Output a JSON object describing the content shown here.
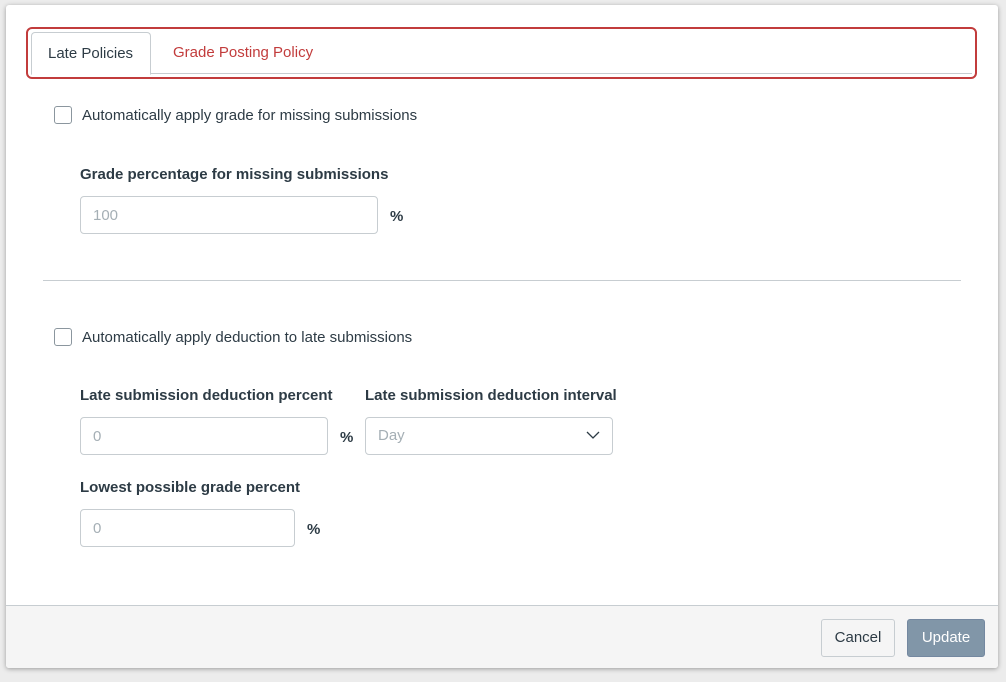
{
  "tabs": [
    {
      "label": "Late Policies",
      "active": true
    },
    {
      "label": "Grade Posting Policy",
      "active": false
    }
  ],
  "missing": {
    "checkbox_label": "Automatically apply grade for missing submissions",
    "checked": false,
    "grade_label": "Grade percentage for missing submissions",
    "grade_placeholder": "100",
    "unit": "%"
  },
  "late": {
    "checkbox_label": "Automatically apply deduction to late submissions",
    "checked": false,
    "deduction_label": "Late submission deduction percent",
    "deduction_placeholder": "0",
    "deduction_unit": "%",
    "interval_label": "Late submission deduction interval",
    "interval_value": "Day",
    "lowest_label": "Lowest possible grade percent",
    "lowest_placeholder": "0",
    "lowest_unit": "%"
  },
  "footer": {
    "cancel_label": "Cancel",
    "update_label": "Update"
  },
  "colors": {
    "accent": "#c23c3c",
    "text": "#2d3b45",
    "border": "#c7cdd1",
    "update_button": "#8196a8"
  }
}
